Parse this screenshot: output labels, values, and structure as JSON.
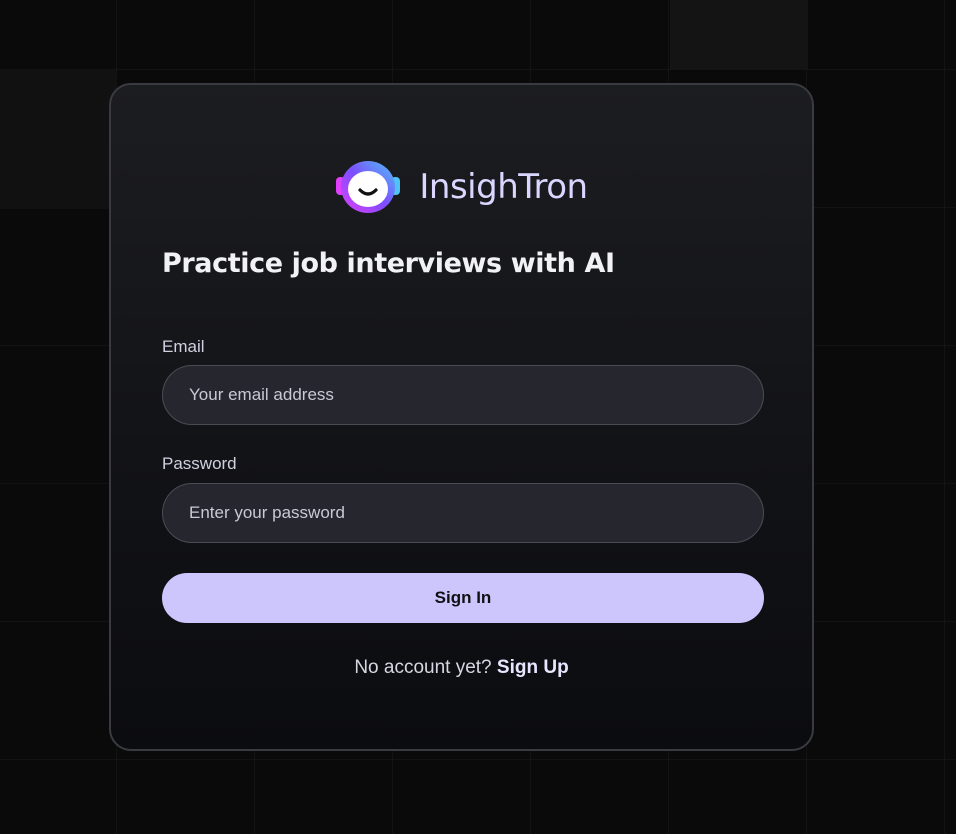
{
  "brand": {
    "name": "InsighTron",
    "logo_icon": "robot-face-icon",
    "logo_colors": {
      "gradient_start": "#4fc3f7",
      "gradient_mid": "#7c4dff",
      "gradient_end": "#e040fb",
      "face": "#ffffff"
    }
  },
  "headline": "Practice job interviews with AI",
  "form": {
    "email": {
      "label": "Email",
      "placeholder": "Your email address",
      "value": ""
    },
    "password": {
      "label": "Password",
      "placeholder": "Enter your password",
      "value": ""
    },
    "submit_label": "Sign In"
  },
  "signup": {
    "prompt": "No account yet?",
    "link_label": "Sign Up"
  },
  "colors": {
    "accent": "#ccc6fd",
    "background": "#0a0a0a",
    "card": "#16171b"
  }
}
